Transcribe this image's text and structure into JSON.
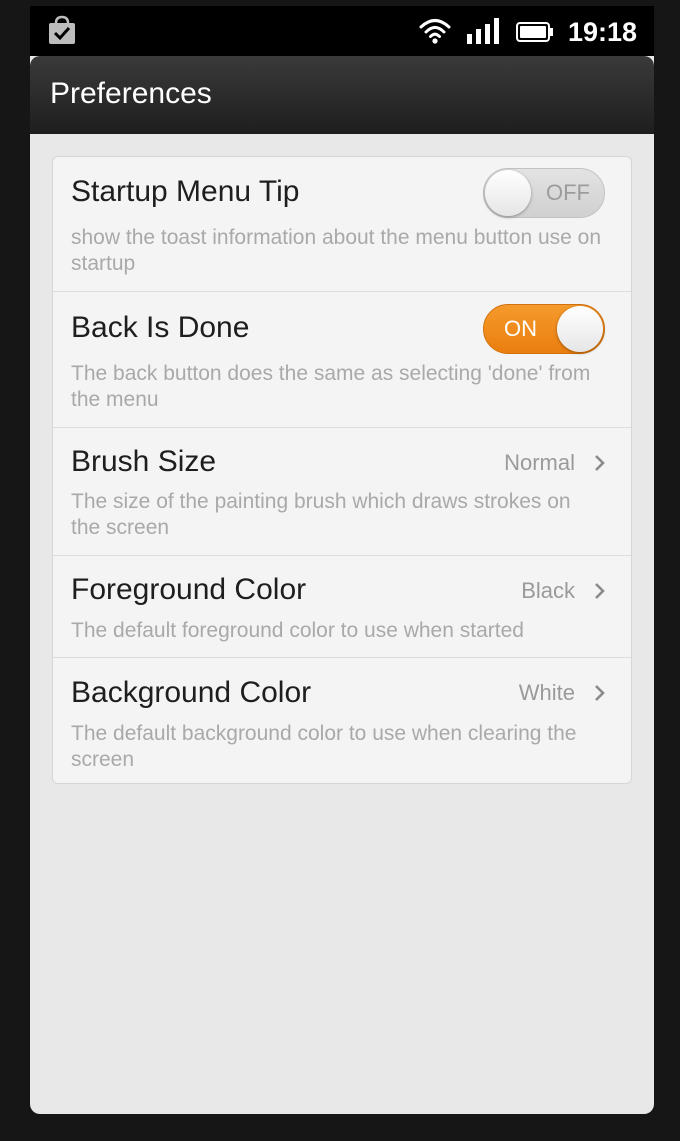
{
  "status_bar": {
    "time": "19:18",
    "icons": [
      "store-icon",
      "wifi-icon",
      "signal-icon",
      "battery-icon"
    ]
  },
  "action_bar": {
    "title": "Preferences"
  },
  "colors": {
    "accent_on": "#F28A1E",
    "action_bar": "#2A2A2A",
    "background": "#E8E8E8",
    "card": "#F4F4F4",
    "title_text": "#1E1E1E",
    "summary_text": "#A9A9A9"
  },
  "preferences": [
    {
      "title": "Startup Menu Tip",
      "summary": "show the toast information about the menu button use on startup",
      "control": "switch",
      "state": "OFF"
    },
    {
      "title": "Back Is Done",
      "summary": "The back button does the same as selecting 'done' from the menu",
      "control": "switch",
      "state": "ON"
    },
    {
      "title": "Brush Size",
      "summary": "The size of the painting brush which draws strokes on the screen",
      "control": "list",
      "value": "Normal"
    },
    {
      "title": "Foreground Color",
      "summary": "The default foreground color to use when started",
      "control": "list",
      "value": "Black"
    },
    {
      "title": "Background Color",
      "summary": "The default background color to use when clearing the screen",
      "control": "list",
      "value": "White"
    }
  ]
}
